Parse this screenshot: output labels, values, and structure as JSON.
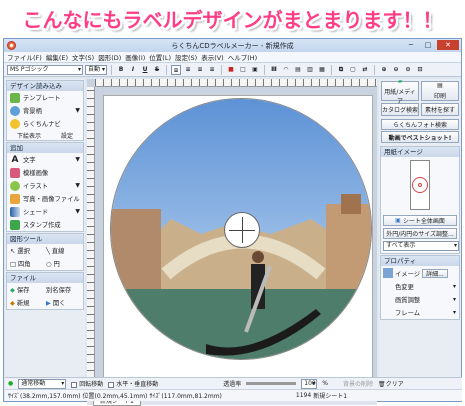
{
  "banner": {
    "text": "こんなにもラベルデザインがまとまります！！",
    "color": "#ff3d86"
  },
  "window": {
    "title": "らくちんCDラベルメーカー - 新規作成",
    "min": "─",
    "max": "□",
    "close": "✕"
  },
  "menu": [
    "ファイル(F)",
    "編集(E)",
    "文字(S)",
    "図形(D)",
    "画像(I)",
    "位置(L)",
    "設定(S)",
    "表示(V)",
    "ヘルプ(H)"
  ],
  "toolbar": {
    "font": "MS Pゴシック",
    "size": "自動",
    "bold": "B",
    "italic": "I",
    "underline": "U",
    "strike": "S"
  },
  "left": {
    "design": {
      "header": "デザイン読み込み",
      "items": [
        "テンプレート",
        "背景柄",
        "らくちんナビ"
      ],
      "sub": [
        "下絵表示",
        "設定"
      ]
    },
    "add": {
      "header": "追加",
      "items": [
        "文字",
        "模様画像",
        "イラスト",
        "写真・画像ファイル",
        "シェード",
        "スタンプ作成"
      ]
    },
    "shape": {
      "header": "図形ツール",
      "items": [
        "選択",
        "直線",
        "四角",
        "円"
      ]
    },
    "file": {
      "header": "ファイル",
      "items": [
        "保存",
        "別名保存",
        "新規",
        "開く"
      ]
    }
  },
  "right": {
    "btns": [
      "用紙/メディア",
      "印刷",
      "カタログ検索",
      "素材を探す",
      "らくちんフォト検索",
      "動画でベストショット!"
    ],
    "paper": {
      "header": "用紙イメージ"
    },
    "sheet": "シート全体画面",
    "sizeadj": "外円/内円のサイズ調整...",
    "view": "すべて表示",
    "prop": {
      "header": "プロパティ",
      "image": "イメージ",
      "detail": "詳細...",
      "items": [
        "色変更",
        "画質調整",
        "フレーム"
      ]
    }
  },
  "tab": "新規シート1",
  "status": {
    "move": "通常移動",
    "rotate": "回転移動",
    "hv": "水平・垂直移動",
    "opacity_label": "透過率",
    "opacity": "100",
    "percent": "%",
    "bgdelete": "背景の削除",
    "clear": "クリア"
  },
  "info": {
    "size": "ｻｲｽﾞ(38.2mm,157.0mm)",
    "pos": "位置(0.2mm,45.1mm)",
    "size2": "ｻｲｽﾞ(117.0mm,81.2mm)",
    "count": "1194",
    "sheetname": "新規シート1"
  }
}
